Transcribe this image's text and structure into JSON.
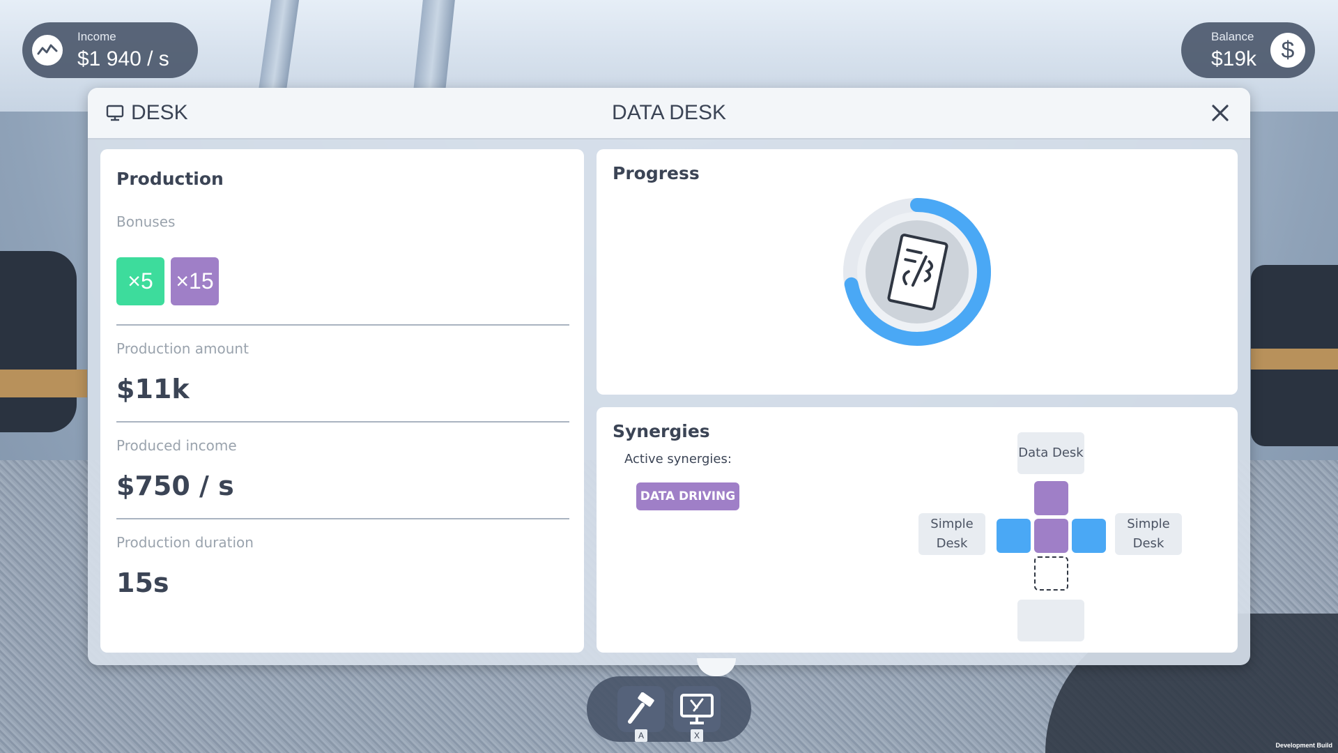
{
  "hud": {
    "income_label": "Income",
    "income_value": "$1 940 / s",
    "income_icon": "income-chart-icon",
    "balance_label": "Balance",
    "balance_value": "$19k",
    "balance_icon_glyph": "$"
  },
  "dialog": {
    "category": "DESK",
    "category_icon": "monitor-icon",
    "title": "DATA DESK",
    "close_icon": "close-icon"
  },
  "production": {
    "title": "Production",
    "bonuses_label": "Bonuses",
    "bonuses": [
      {
        "text": "×5",
        "color": "#3ddc9c"
      },
      {
        "text": "×15",
        "color": "#9f7fc7"
      }
    ],
    "amount_label": "Production amount",
    "amount_value": "$11k",
    "income_label": "Produced income",
    "income_value": "$750 / s",
    "duration_label": "Production duration",
    "duration_value": "15s"
  },
  "progress": {
    "title": "Progress",
    "fraction": 0.72,
    "ring_color": "#4aa8f5",
    "icon": "document-code-icon"
  },
  "synergies": {
    "title": "Synergies",
    "active_label": "Active synergies:",
    "active": [
      "DATA DRIVING"
    ],
    "top_label": "Data Desk",
    "left_label_line1": "Simple",
    "left_label_line2": "Desk",
    "right_label_line1": "Simple",
    "right_label_line2": "Desk",
    "colors": {
      "purple": "#9f7fc7",
      "blue": "#4aa8f5"
    }
  },
  "toolbar": {
    "build_icon": "hammer-icon",
    "build_key": "A",
    "remove_icon": "monitor-remove-icon",
    "remove_key": "X"
  },
  "footer": {
    "dev_build": "Development Build"
  }
}
